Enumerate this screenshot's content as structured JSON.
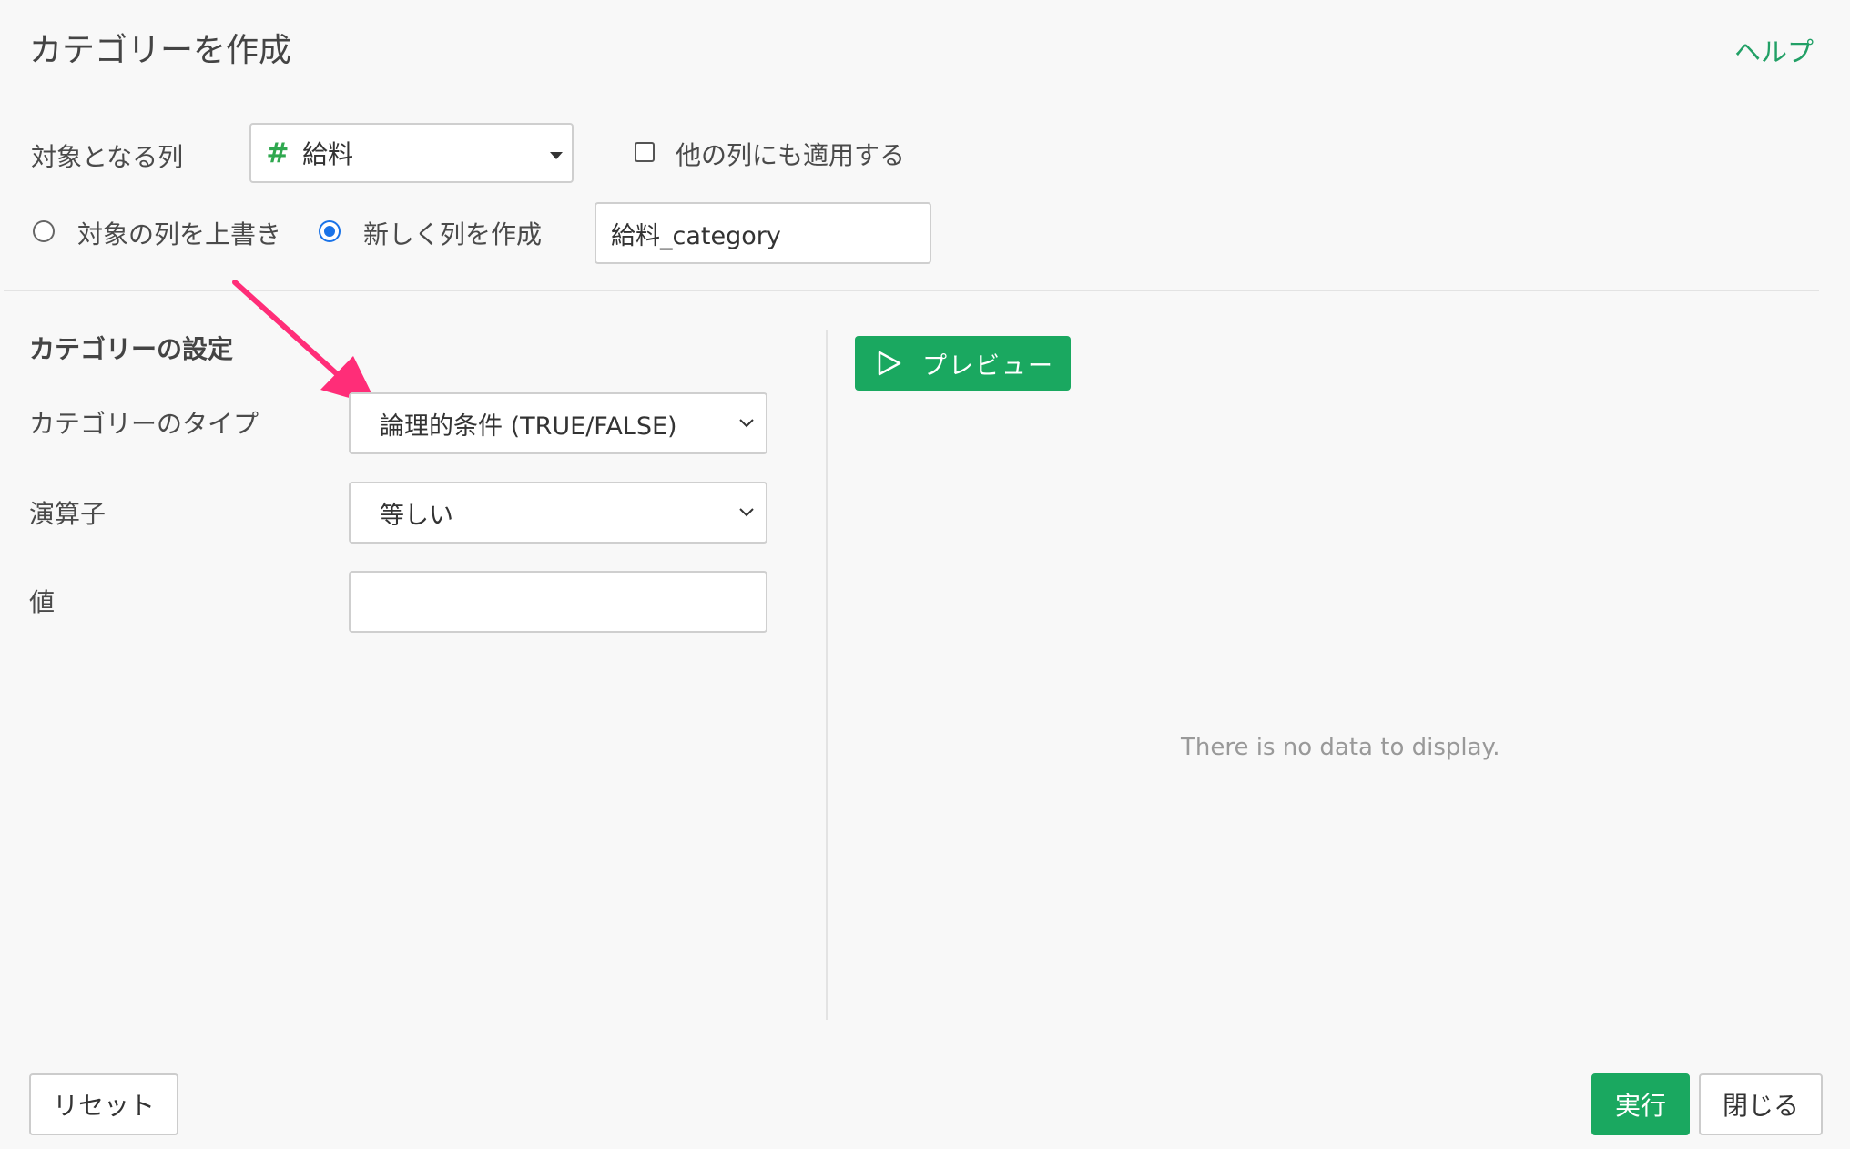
{
  "dialog": {
    "title": "カテゴリーを作成",
    "help_link": "ヘルプ"
  },
  "target": {
    "label": "対象となる列",
    "column_icon": "hash-icon",
    "column_icon_glyph": "#",
    "column_value": "給料",
    "apply_other_label": "他の列にも適用する",
    "apply_other_checked": false
  },
  "output": {
    "overwrite_label": "対象の列を上書き",
    "new_column_label": "新しく列を作成",
    "selected": "new_column",
    "new_column_name": "給料_category"
  },
  "settings": {
    "section_title": "カテゴリーの設定",
    "type_label": "カテゴリーのタイプ",
    "type_value": "論理的条件 (TRUE/FALSE)",
    "operator_label": "演算子",
    "operator_value": "等しい",
    "value_label": "値",
    "value": ""
  },
  "preview": {
    "button_label": "プレビュー",
    "empty_message": "There is no data to display."
  },
  "footer": {
    "reset_label": "リセット",
    "run_label": "実行",
    "close_label": "閉じる"
  },
  "colors": {
    "accent_green": "#1aa860",
    "radio_blue": "#1a73e8",
    "annotation_arrow": "#ff2d78",
    "hash_green": "#2fa84f"
  }
}
